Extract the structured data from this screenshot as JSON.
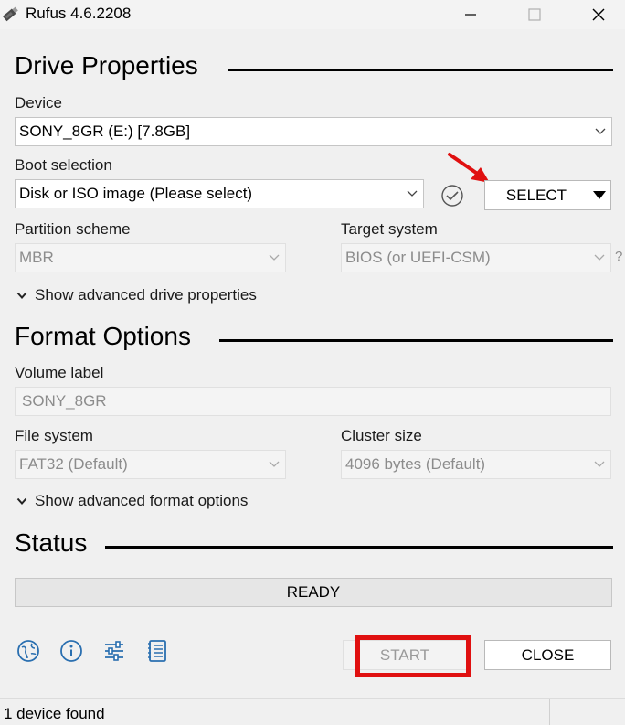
{
  "window": {
    "title": "Rufus 4.6.2208"
  },
  "drive_properties": {
    "heading": "Drive Properties",
    "device_label": "Device",
    "device_value": "SONY_8GR (E:) [7.8GB]",
    "boot_selection_label": "Boot selection",
    "boot_selection_value": "Disk or ISO image (Please select)",
    "select_button_label": "SELECT",
    "partition_scheme_label": "Partition scheme",
    "partition_scheme_value": "MBR",
    "target_system_label": "Target system",
    "target_system_value": "BIOS (or UEFI-CSM)",
    "target_system_help": "?",
    "advanced_toggle_label": "Show advanced drive properties"
  },
  "format_options": {
    "heading": "Format Options",
    "volume_label_label": "Volume label",
    "volume_label_value": "SONY_8GR",
    "file_system_label": "File system",
    "file_system_value": "FAT32 (Default)",
    "cluster_size_label": "Cluster size",
    "cluster_size_value": "4096 bytes (Default)",
    "advanced_toggle_label": "Show advanced format options"
  },
  "status": {
    "heading": "Status",
    "progress_text": "READY"
  },
  "toolbar": {
    "icons": [
      "language-globe-icon",
      "info-icon",
      "settings-sliders-icon",
      "log-icon"
    ]
  },
  "actions": {
    "start_label": "START",
    "close_label": "CLOSE"
  },
  "status_bar": {
    "text": "1 device found"
  },
  "colors": {
    "accent_blue": "#2a6fb0",
    "highlight_red": "#e01010",
    "disabled_text": "#8c8c8c"
  }
}
